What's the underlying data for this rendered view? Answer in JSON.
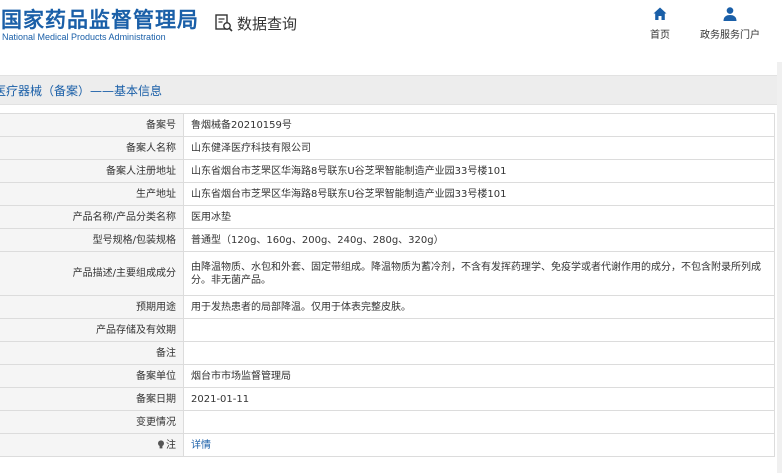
{
  "header": {
    "logo_cn": "国家药品监督管理局",
    "logo_en": "National Medical Products Administration",
    "query_label": "数据查询",
    "nav": [
      {
        "label": "首页",
        "icon": "home-icon"
      },
      {
        "label": "政务服务门户",
        "icon": "user-icon"
      }
    ]
  },
  "section": {
    "title": "医疗器械（备案）——基本信息"
  },
  "table": {
    "rows": [
      {
        "key": "备案号",
        "value": "鲁烟械备20210159号"
      },
      {
        "key": "备案人名称",
        "value": "山东健泽医疗科技有限公司"
      },
      {
        "key": "备案人注册地址",
        "value": "山东省烟台市芝罘区华海路8号联东U谷芝罘智能制造产业园33号楼101"
      },
      {
        "key": "生产地址",
        "value": "山东省烟台市芝罘区华海路8号联东U谷芝罘智能制造产业园33号楼101"
      },
      {
        "key": "产品名称/产品分类名称",
        "value": "医用冰垫"
      },
      {
        "key": "型号规格/包装规格",
        "value": "普通型（120g、160g、200g、240g、280g、320g）"
      },
      {
        "key": "产品描述/主要组成成分",
        "value": "由降温物质、水包和外套、固定带组成。降温物质为蓄冷剂，不含有发挥药理学、免疫学或者代谢作用的成分，不包含附录所列成分。非无菌产品。"
      },
      {
        "key": "预期用途",
        "value": "用于发热患者的局部降温。仅用于体表完整皮肤。"
      },
      {
        "key": "产品存储及有效期",
        "value": ""
      },
      {
        "key": "备注",
        "value": ""
      },
      {
        "key": "备案单位",
        "value": "烟台市市场监督管理局"
      },
      {
        "key": "备案日期",
        "value": "2021-01-11"
      },
      {
        "key": "变更情况",
        "value": ""
      },
      {
        "key": "注",
        "value": "详情"
      }
    ]
  },
  "colors": {
    "brand_blue": "#1a5fa8",
    "key_cell_bg": "#f5f5f5",
    "section_bg": "#ededed"
  }
}
